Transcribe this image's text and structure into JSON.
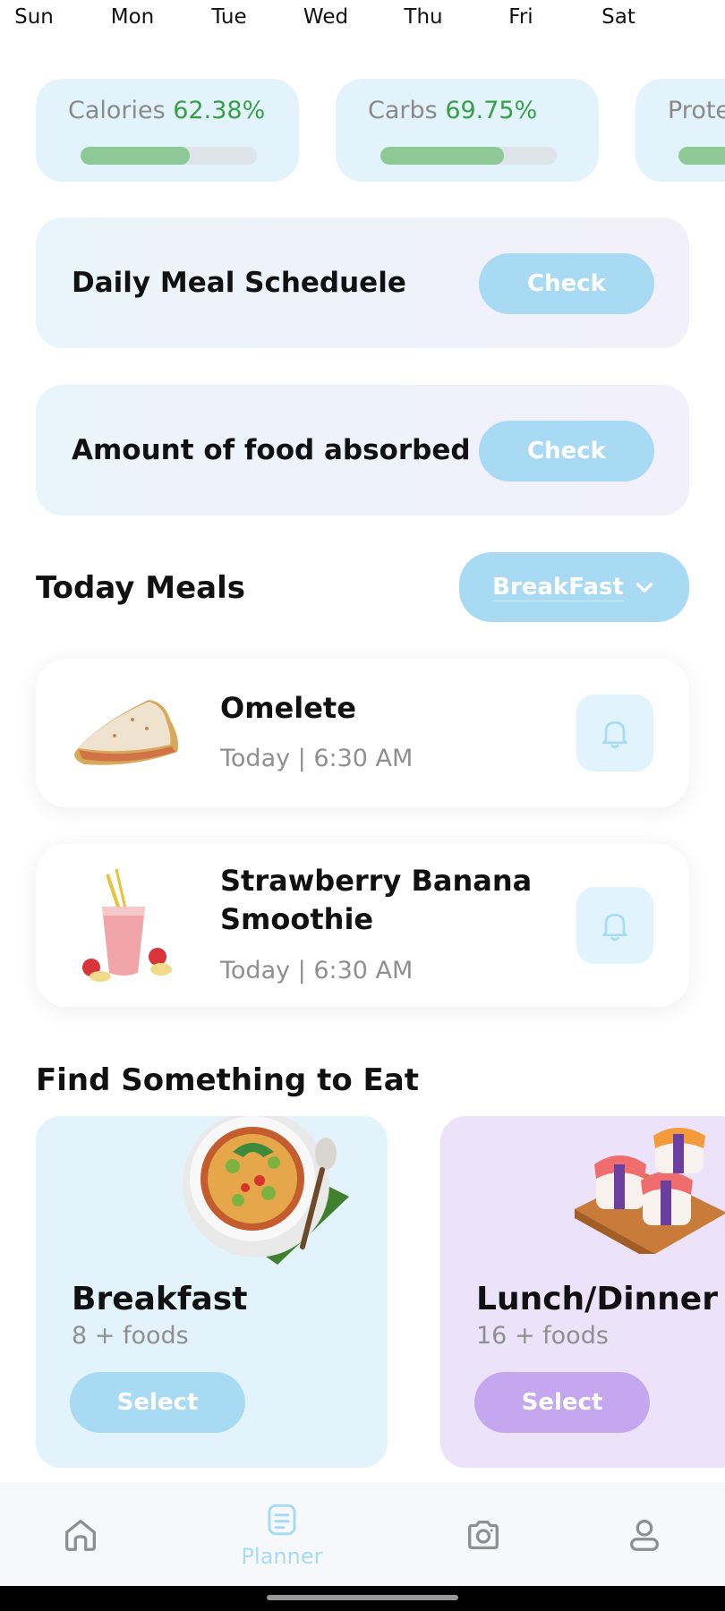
{
  "week_days": [
    "Sun",
    "Mon",
    "Tue",
    "Wed",
    "Thu",
    "Fri",
    "Sat"
  ],
  "stats": [
    {
      "label": "Calories",
      "percent_text": "62.38%",
      "progress": 0.62
    },
    {
      "label": "Carbs",
      "percent_text": "69.75%",
      "progress": 0.7
    },
    {
      "label": "Prote",
      "percent_text": "",
      "progress": 0.5
    }
  ],
  "cards": {
    "schedule": {
      "title": "Daily Meal Scheduele",
      "button": "Check"
    },
    "absorbed": {
      "title": "Amount of food absorbed",
      "button": "Check"
    }
  },
  "today_meals": {
    "title": "Today Meals",
    "filter": "BreakFast",
    "items": [
      {
        "name": "Omelete",
        "time": "Today | 6:30 AM",
        "icon": "omelete-image"
      },
      {
        "name": "Strawberry Banana Smoothie",
        "time": "Today | 6:30 AM",
        "icon": "smoothie-image"
      }
    ]
  },
  "find": {
    "title": "Find Something to Eat",
    "categories": [
      {
        "name": "Breakfast",
        "count": "8 + foods",
        "button": "Select",
        "color": "#e3f3fc",
        "icon": "curry-bowl-image"
      },
      {
        "name": "Lunch/Dinner",
        "count": "16 + foods",
        "button": "Select",
        "color": "#ece2fa",
        "icon": "sushi-image"
      }
    ]
  },
  "nav": {
    "items": [
      {
        "icon": "home-icon",
        "label": ""
      },
      {
        "icon": "planner-icon",
        "label": "Planner",
        "active": true
      },
      {
        "icon": "camera-icon",
        "label": ""
      },
      {
        "icon": "profile-icon",
        "label": ""
      }
    ],
    "active_color": "#a6dcf3"
  },
  "colors": {
    "accent_blue": "#a9daf4",
    "accent_purple": "#c5a7f0",
    "progress_green": "#8ec897",
    "percent_green": "#37a047"
  }
}
